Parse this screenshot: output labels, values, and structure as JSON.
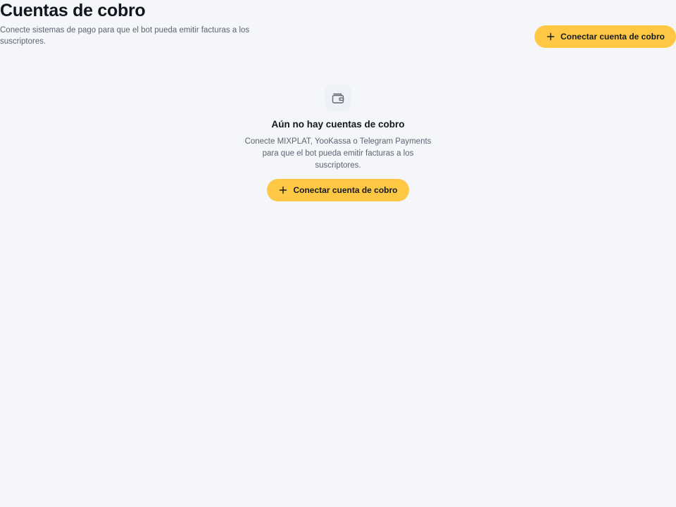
{
  "header": {
    "title": "Cuentas de cobro",
    "subtitle": "Conecte sistemas de pago para que el bot pueda emitir facturas a los suscriptores.",
    "connect_button_label": "Conectar cuenta de cobro",
    "connect_button_icon": "plus-icon"
  },
  "empty_state": {
    "icon": "wallet-icon",
    "title": "Aún no hay cuentas de cobro",
    "description": "Conecte MIXPLAT, YooKassa o Telegram Payments para que el bot pueda emitir facturas a los suscriptores.",
    "connect_button_label": "Conectar cuenta de cobro",
    "connect_button_icon": "plus-icon"
  },
  "colors": {
    "background": "#f4f6f9",
    "accent": "#ffc844",
    "text_primary": "#12171f",
    "text_secondary": "#5b6573",
    "icon_tile": "#eef1f5",
    "icon_stroke": "#5f6a78"
  }
}
